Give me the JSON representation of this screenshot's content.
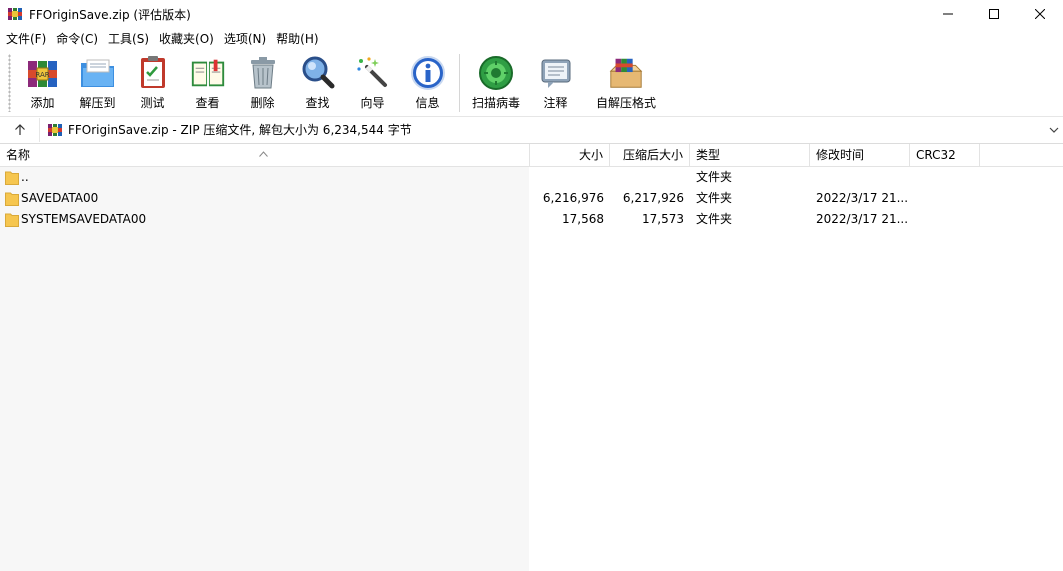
{
  "window": {
    "title": "FFOriginSave.zip (评估版本)",
    "controls": [
      "minimize-icon",
      "maximize-icon",
      "close-icon"
    ]
  },
  "menu": [
    "文件(F)",
    "命令(C)",
    "工具(S)",
    "收藏夹(O)",
    "选项(N)",
    "帮助(H)"
  ],
  "toolbar": {
    "tools": [
      {
        "label": "添加",
        "icon": "add-archive-icon"
      },
      {
        "label": "解压到",
        "icon": "extract-to-icon"
      },
      {
        "label": "测试",
        "icon": "test-icon"
      },
      {
        "label": "查看",
        "icon": "view-icon"
      },
      {
        "label": "删除",
        "icon": "delete-icon"
      },
      {
        "label": "查找",
        "icon": "find-icon"
      },
      {
        "label": "向导",
        "icon": "wizard-icon"
      },
      {
        "label": "信息",
        "icon": "info-icon"
      },
      {
        "label": "扫描病毒",
        "icon": "virus-scan-icon"
      },
      {
        "label": "注释",
        "icon": "comment-icon"
      },
      {
        "label": "自解压格式",
        "icon": "sfx-icon"
      }
    ]
  },
  "address": {
    "text": "FFOriginSave.zip - ZIP 压缩文件, 解包大小为 6,234,544 字节"
  },
  "columns": {
    "name": "名称",
    "size": "大小",
    "packed": "压缩后大小",
    "type": "类型",
    "modified": "修改时间",
    "crc": "CRC32"
  },
  "rows": [
    {
      "name": "..",
      "size": "",
      "packed": "",
      "type": "文件夹",
      "modified": "",
      "crc": ""
    },
    {
      "name": "SAVEDATA00",
      "size": "6,216,976",
      "packed": "6,217,926",
      "type": "文件夹",
      "modified": "2022/3/17 21...",
      "crc": ""
    },
    {
      "name": "SYSTEMSAVEDATA00",
      "size": "17,568",
      "packed": "17,573",
      "type": "文件夹",
      "modified": "2022/3/17 21...",
      "crc": ""
    }
  ],
  "colors": {
    "folder": "#f6c64f",
    "accent": "#1e6fd9"
  }
}
